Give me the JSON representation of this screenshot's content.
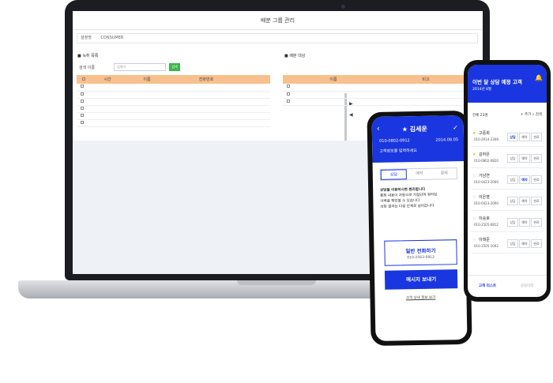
{
  "laptop": {
    "window_title": "배분 그룹 관리",
    "filter": {
      "label": "설정명",
      "value": "CONSUMER"
    },
    "left": {
      "section_title": "■ 녹취 목록",
      "control_label": "검색",
      "control_select": "이름",
      "search_placeholder": "검색어",
      "search_button": "검색",
      "columns": [
        "",
        "시간",
        "이름",
        "전화번호",
        ""
      ]
    },
    "right": {
      "section_title": "■ 배분 대상",
      "columns": [
        "",
        "이름",
        "비고"
      ]
    },
    "arrows": [
      "▶",
      "◀"
    ]
  },
  "phoneA": {
    "back_icon": "‹",
    "title": "★ 김세운",
    "check_icon": "✓",
    "phone": "010-0802-0912",
    "date": "2014.08.05",
    "memo": "고객정보를 입력하세요",
    "tabs": [
      "상담",
      "예약",
      "결제"
    ],
    "body_lines": [
      "상담을 이용하시면 편리합니다",
      "통화 내용이 자동으로 저장되며 정리된",
      "이력을 확인할 수 있습니다",
      "상담 결과는 다음 단계로 넘어갑니다"
    ],
    "call_button": {
      "title": "일반 전화하기",
      "sub": "010-2563-0912"
    },
    "message_button": "메시지 보내기",
    "footer_link": "고객 상세 정보 보기"
  },
  "phoneB": {
    "title": "이번 달 상담 예정 고객",
    "subtitle": "2014년 8월",
    "bell_icon": "🔔",
    "count_label": "전체 23명",
    "add_label": "+ 추가",
    "search_label": "검색",
    "row_buttons": [
      "상담",
      "예약",
      "완료"
    ],
    "customers": [
      {
        "star": "★",
        "name": "고중희",
        "phone": "010-2014-2308",
        "active": 0
      },
      {
        "star": "★",
        "name": "김하은",
        "phone": "010-0802-0820",
        "active": -1
      },
      {
        "star": "☆",
        "name": "가남연",
        "phone": "010-0423-2000",
        "active": 1
      },
      {
        "star": "☆",
        "name": "이은영",
        "phone": "010-0423-2000",
        "active": -1
      },
      {
        "star": "☆",
        "name": "이승호",
        "phone": "010-2505-0812",
        "active": -1
      },
      {
        "star": "☆",
        "name": "이태준",
        "phone": "010-2505-1002",
        "active": -1
      }
    ],
    "footer": [
      "고객 리스트",
      "상담이력"
    ]
  },
  "colors": {
    "brand_blue": "#1a36e0",
    "header_orange": "#f7c08c",
    "search_green": "#3cb64a"
  }
}
